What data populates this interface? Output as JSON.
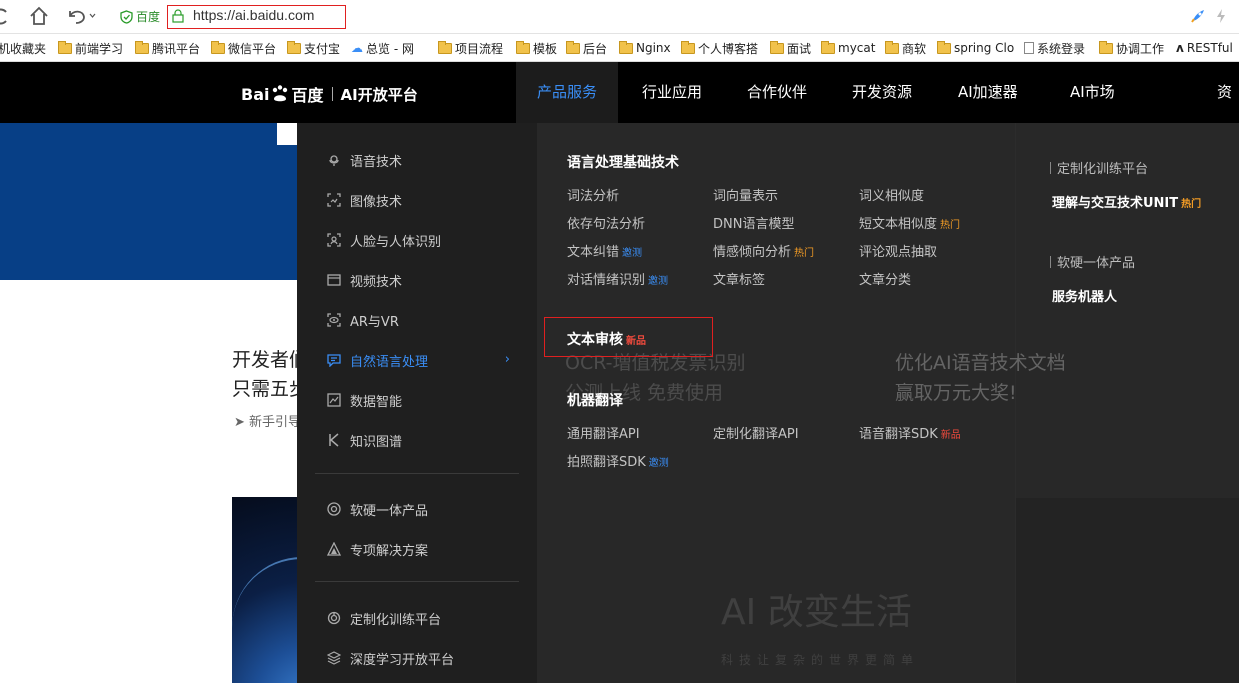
{
  "browser": {
    "site_badge": "百度",
    "url": "https://ai.baidu.com",
    "bookmarks": [
      {
        "label": "机收藏夹",
        "type": "none"
      },
      {
        "label": "前端学习",
        "type": "folder"
      },
      {
        "label": "腾讯平台",
        "type": "folder"
      },
      {
        "label": "微信平台",
        "type": "folder"
      },
      {
        "label": "支付宝",
        "type": "folder"
      },
      {
        "label": "总览 - 网",
        "type": "cloud"
      },
      {
        "label": "项目流程",
        "type": "folder"
      },
      {
        "label": "模板",
        "type": "folder"
      },
      {
        "label": "后台",
        "type": "folder"
      },
      {
        "label": "Nginx",
        "type": "folder"
      },
      {
        "label": "个人博客搭",
        "type": "folder"
      },
      {
        "label": "面试",
        "type": "folder"
      },
      {
        "label": "mycat",
        "type": "folder"
      },
      {
        "label": "商软",
        "type": "folder"
      },
      {
        "label": "spring Clo",
        "type": "folder"
      },
      {
        "label": "系统登录",
        "type": "page"
      },
      {
        "label": "协调工作",
        "type": "folder"
      },
      {
        "label": "RESTful",
        "type": "rest"
      }
    ]
  },
  "site": {
    "logo_text_1": "Bai",
    "logo_text_2": "百度",
    "platform": "AI开放平台",
    "nav": [
      "产品服务",
      "行业应用",
      "合作伙伴",
      "开发资源",
      "AI加速器",
      "AI市场",
      "资讯"
    ]
  },
  "menu": {
    "categories": [
      {
        "label": "语音技术",
        "icon": "mic-icon"
      },
      {
        "label": "图像技术",
        "icon": "image-scan-icon"
      },
      {
        "label": "人脸与人体识别",
        "icon": "face-scan-icon"
      },
      {
        "label": "视频技术",
        "icon": "video-icon"
      },
      {
        "label": "AR与VR",
        "icon": "eye-icon"
      },
      {
        "label": "自然语言处理",
        "icon": "chat-icon"
      },
      {
        "label": "数据智能",
        "icon": "chart-icon"
      },
      {
        "label": "知识图谱",
        "icon": "k-icon"
      }
    ],
    "categories_2": [
      {
        "label": "软硬一体产品",
        "icon": "target-icon"
      },
      {
        "label": "专项解决方案",
        "icon": "triangle-icon"
      }
    ],
    "categories_3": [
      {
        "label": "定制化训练平台",
        "icon": "gear-icon"
      },
      {
        "label": "深度学习开放平台",
        "icon": "layers-icon"
      }
    ],
    "nlp_title": "语言处理基础技术",
    "nlp_links": [
      {
        "label": "词法分析",
        "tag": ""
      },
      {
        "label": "词向量表示",
        "tag": ""
      },
      {
        "label": "词义相似度",
        "tag": ""
      },
      {
        "label": "依存句法分析",
        "tag": ""
      },
      {
        "label": "DNN语言模型",
        "tag": ""
      },
      {
        "label": "短文本相似度",
        "tag": "热门"
      },
      {
        "label": "文本纠错",
        "tag": "邀测"
      },
      {
        "label": "情感倾向分析",
        "tag": "热门"
      },
      {
        "label": "评论观点抽取",
        "tag": ""
      },
      {
        "label": "对话情绪识别",
        "tag": "邀测"
      },
      {
        "label": "文章标签",
        "tag": ""
      },
      {
        "label": "文章分类",
        "tag": ""
      }
    ],
    "audit_title": "文本审核",
    "audit_tag": "新品",
    "mt_title": "机器翻译",
    "mt_links": [
      {
        "label": "通用翻译API",
        "tag": ""
      },
      {
        "label": "定制化翻译API",
        "tag": ""
      },
      {
        "label": "语音翻译SDK",
        "tag": "新品"
      },
      {
        "label": "拍照翻译SDK",
        "tag": "邀测"
      }
    ],
    "right_head_1": "定制化训练平台",
    "right_item_1": "理解与交互技术UNIT",
    "right_item_1_tag": "热门",
    "right_head_2": "软硬一体产品",
    "right_item_2": "服务机器人"
  },
  "page": {
    "news_line1": "开发者们",
    "news_line2": "只需五步",
    "news_sub": "新手引导",
    "ghost_a1": "OCR-増值税发票识别",
    "ghost_a2": "公测上线 免费使用",
    "ghost_b1": "优化AI语音技术文档",
    "ghost_b2": "赢取万元大奖!",
    "ghost_banner": "AI 改变生活",
    "ghost_banner_sub": "科技让复杂的世界更简单"
  },
  "colors": {
    "accent": "#3a8ef6",
    "hot": "#f39c25",
    "new": "#ef4a3d",
    "hero_blue": "#073f86"
  }
}
